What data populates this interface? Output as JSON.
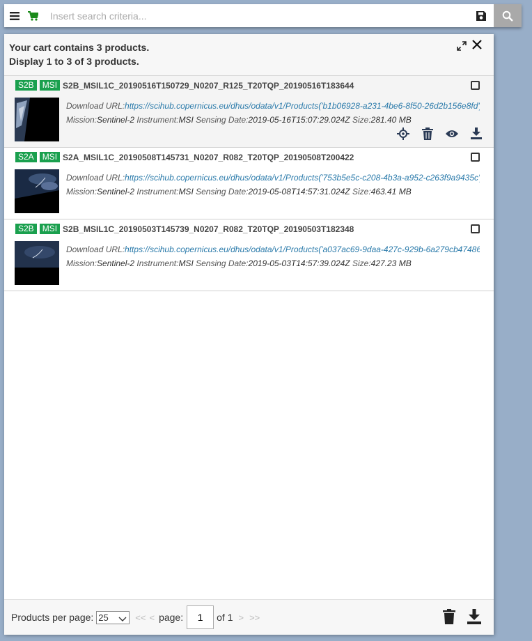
{
  "search": {
    "placeholder": "Insert search criteria..."
  },
  "cart": {
    "summary": "Your cart contains 3 products.",
    "display": "Display 1 to 3 of 3 products."
  },
  "labels": {
    "download_url": "Download URL:",
    "mission": "Mission:",
    "instrument": "Instrument:",
    "sensing_date": "Sensing Date:",
    "size": "Size:"
  },
  "products": [
    {
      "satellite": "S2B",
      "instrument_badge": "MSI",
      "name": "S2B_MSIL1C_20190516T150729_N0207_R125_T20TQP_20190516T183644",
      "url": "https://scihub.copernicus.eu/dhus/odata/v1/Products('b1b06928-a231-4be6-8f50-26d2b156e8fd')/$value",
      "mission": "Sentinel-2",
      "instrument": "MSI",
      "sensing_date": "2019-05-16T15:07:29.024Z",
      "size": "281.40 MB"
    },
    {
      "satellite": "S2A",
      "instrument_badge": "MSI",
      "name": "S2A_MSIL1C_20190508T145731_N0207_R082_T20TQP_20190508T200422",
      "url": "https://scihub.copernicus.eu/dhus/odata/v1/Products('753b5e5c-c208-4b3a-a952-c263f9a9435c')/$value",
      "mission": "Sentinel-2",
      "instrument": "MSI",
      "sensing_date": "2019-05-08T14:57:31.024Z",
      "size": "463.41 MB"
    },
    {
      "satellite": "S2B",
      "instrument_badge": "MSI",
      "name": "S2B_MSIL1C_20190503T145739_N0207_R082_T20TQP_20190503T182348",
      "url": "https://scihub.copernicus.eu/dhus/odata/v1/Products('a037ac69-9daa-427c-929b-6a279cb47486')/$value",
      "mission": "Sentinel-2",
      "instrument": "MSI",
      "sensing_date": "2019-05-03T14:57:39.024Z",
      "size": "427.23 MB"
    }
  ],
  "footer": {
    "per_page_label": "Products per page:",
    "per_page_value": "25",
    "first": "<<",
    "prev": "<",
    "page_label": "page:",
    "page_value": "1",
    "of_label": "of 1",
    "next": ">",
    "last": ">>"
  },
  "colors": {
    "badge": "#1aa04e",
    "link": "#2a7aaa",
    "cart_icon": "#1a8a1a",
    "background": "#98aec8"
  }
}
